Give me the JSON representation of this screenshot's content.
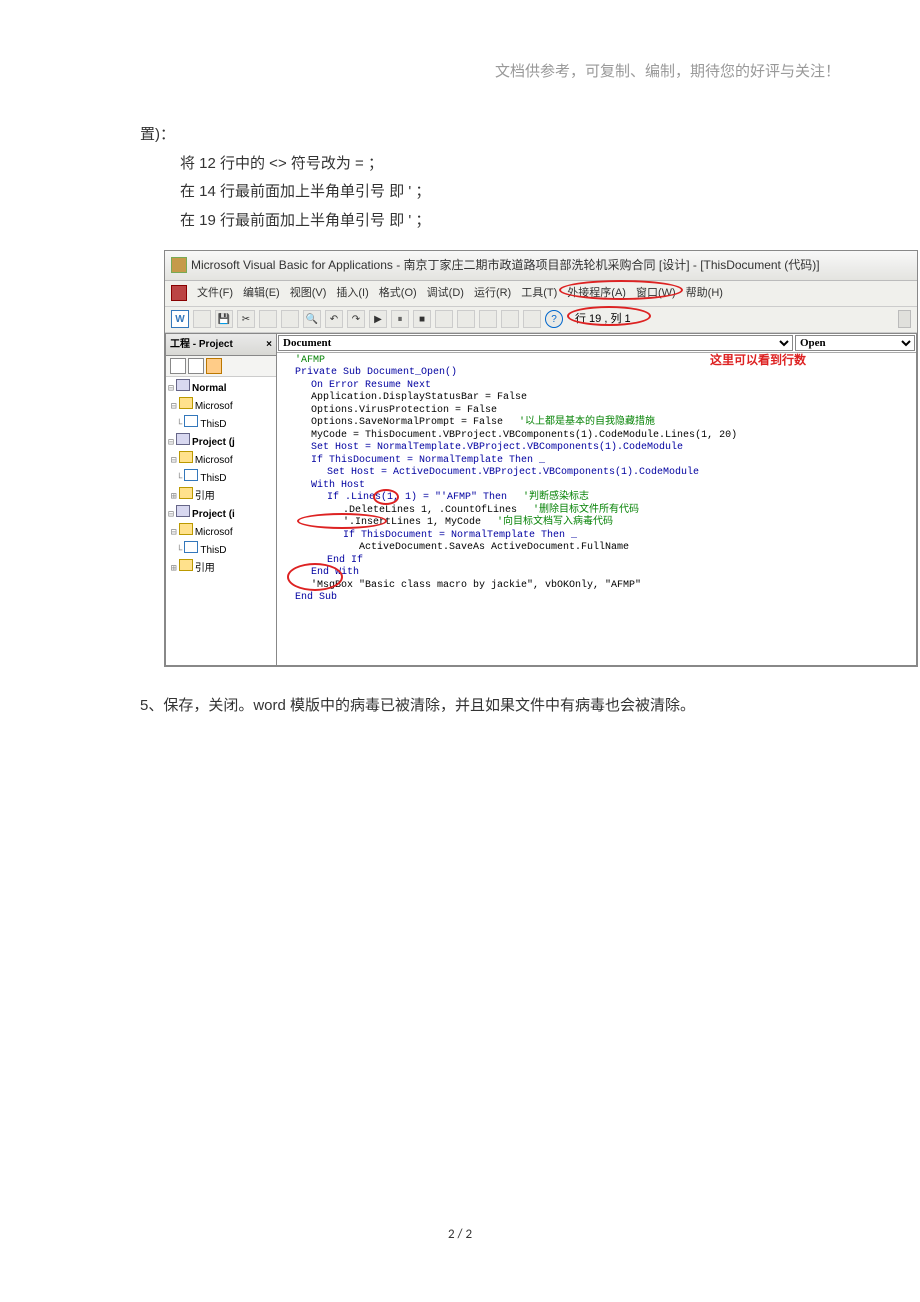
{
  "header": {
    "note": "文档供参考，可复制、编制，期待您的好评与关注！"
  },
  "text": {
    "line1": "置)：",
    "step1": "将 12 行中的  <>  符号改为  =  ；",
    "step2": "在 14 行最前面加上半角单引号 即 ' ；",
    "step3": "在 19 行最前面加上半角单引号 即 ' ；",
    "after": "5、保存，关闭。word 模版中的病毒已被清除，并且如果文件中有病毒也会被清除。"
  },
  "vba": {
    "title": "Microsoft Visual Basic for Applications - 南京丁家庄二期市政道路项目部洗轮机采购合同 [设计] - [ThisDocument (代码)]",
    "menus": {
      "file": "文件(F)",
      "edit": "编辑(E)",
      "view": "视图(V)",
      "insert": "插入(I)",
      "format": "格式(O)",
      "debug": "调试(D)",
      "run": "运行(R)",
      "tools": "工具(T)",
      "addins": "外接程序(A)",
      "window": "窗口(W)",
      "help": "帮助(H)"
    },
    "toolbar_position": "行 19 , 列 1",
    "project_title": "工程 - Project",
    "tree": {
      "root": "Normal",
      "ms": "Microsof",
      "thisd": "ThisD",
      "proj1": "Project (j",
      "ref": "引用",
      "proj2": "Project (i"
    },
    "left_select": "Document",
    "right_select": "Open",
    "code_note": "这里可以看到行数",
    "code": [
      {
        "cls": "c-green",
        "indent": 0,
        "t": "'AFMP"
      },
      {
        "cls": "c-blue",
        "indent": 0,
        "t": "Private Sub Document_Open()"
      },
      {
        "cls": "c-blue",
        "indent": 1,
        "t": "On Error Resume Next"
      },
      {
        "cls": "c-black",
        "indent": 1,
        "t": "Application.DisplayStatusBar = False"
      },
      {
        "cls": "c-black",
        "indent": 1,
        "t": "Options.VirusProtection = False"
      },
      {
        "cls": "c-black",
        "indent": 1,
        "t": "Options.SaveNormalPrompt = False",
        "cmt": "'以上都是基本的自我隐藏措施"
      },
      {
        "cls": "c-black",
        "indent": 1,
        "t": "MyCode = ThisDocument.VBProject.VBComponents(1).CodeModule.Lines(1, 20)"
      },
      {
        "cls": "c-blue",
        "indent": 1,
        "t": "Set Host = NormalTemplate.VBProject.VBComponents(1).CodeModule"
      },
      {
        "cls": "c-blue",
        "indent": 1,
        "t": "If ThisDocument = NormalTemplate Then _"
      },
      {
        "cls": "c-blue",
        "indent": 2,
        "t": "Set Host = ActiveDocument.VBProject.VBComponents(1).CodeModule"
      },
      {
        "cls": "c-blue",
        "indent": 1,
        "t": "With Host"
      },
      {
        "cls": "c-blue",
        "indent": 2,
        "t": "If .Lines(1, 1) = \"'AFMP\" Then",
        "cmt": "'判断感染标志"
      },
      {
        "cls": "c-black",
        "indent": 3,
        "t": ".DeleteLines 1, .CountOfLines",
        "cmt": "'删除目标文件所有代码"
      },
      {
        "cls": "c-black",
        "indent": 3,
        "t": "'.InsertLines 1, MyCode",
        "cmt": "'向目标文档写入病毒代码"
      },
      {
        "cls": "c-blue",
        "indent": 3,
        "t": "If ThisDocument = NormalTemplate Then _"
      },
      {
        "cls": "c-black",
        "indent": 4,
        "t": "ActiveDocument.SaveAs ActiveDocument.FullName"
      },
      {
        "cls": "c-blue",
        "indent": 2,
        "t": "End If"
      },
      {
        "cls": "c-blue",
        "indent": 1,
        "t": "End With"
      },
      {
        "cls": "c-black",
        "indent": 1,
        "t": "'MsgBox \"Basic class macro by jackie\", vbOKOnly, \"AFMP\""
      },
      {
        "cls": "c-blue",
        "indent": 0,
        "t": "End Sub"
      }
    ]
  },
  "footer": "2 / 2"
}
